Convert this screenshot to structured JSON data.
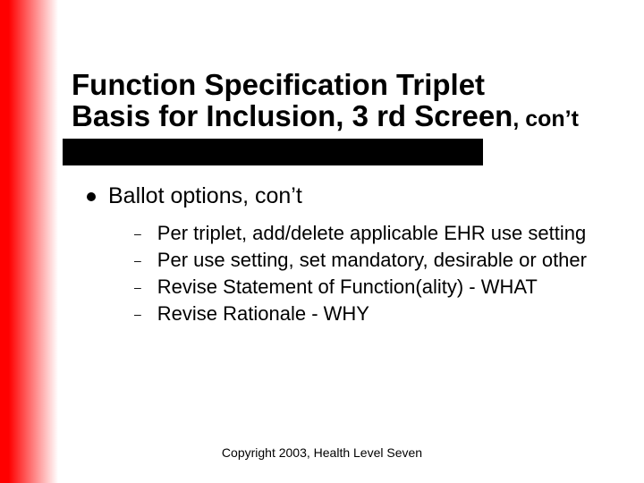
{
  "title": {
    "line1": "Function Specification Triplet",
    "line2_main": "Basis for Inclusion, 3 rd Screen",
    "line2_sub": ", con’t"
  },
  "bullet": {
    "label": "Ballot options, con’t"
  },
  "sub_items": [
    "Per triplet, add/delete applicable EHR use setting",
    "Per use setting, set mandatory, desirable or other",
    "Revise Statement of Function(ality) - WHAT",
    "Revise Rationale - WHY"
  ],
  "footer": "Copyright 2003, Health Level Seven"
}
